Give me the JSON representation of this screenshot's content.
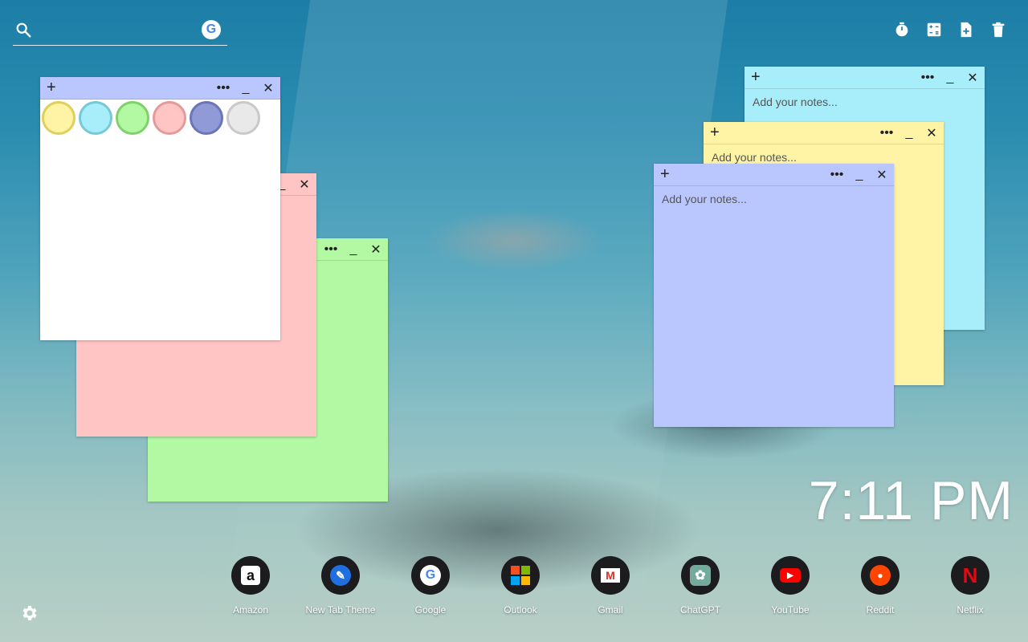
{
  "search": {
    "placeholder": "",
    "engine_badge": "G"
  },
  "tools": [
    {
      "name": "timer-icon"
    },
    {
      "name": "calculator-icon"
    },
    {
      "name": "new-note-icon"
    },
    {
      "name": "trash-icon"
    }
  ],
  "notes": {
    "placeholder": "Add your notes...",
    "plus": "+",
    "more": "•••",
    "minimize": "_",
    "close": "✕"
  },
  "swatch_colors": [
    "#fff3a6",
    "#a8eefa",
    "#b3f9a4",
    "#ffc4c4",
    "#8f9ad6",
    "#e9e9e9"
  ],
  "clock": {
    "time": "7:11 PM"
  },
  "apps": [
    {
      "label": "Amazon",
      "glyph": "a"
    },
    {
      "label": "New Tab Theme",
      "glyph": "✎"
    },
    {
      "label": "Google",
      "glyph": "G"
    },
    {
      "label": "Outlook",
      "glyph": "⊞"
    },
    {
      "label": "Gmail",
      "glyph": "M"
    },
    {
      "label": "ChatGPT",
      "glyph": "✿"
    },
    {
      "label": "YouTube",
      "glyph": "▶"
    },
    {
      "label": "Reddit",
      "glyph": "●"
    },
    {
      "label": "Netflix",
      "glyph": "N"
    }
  ]
}
